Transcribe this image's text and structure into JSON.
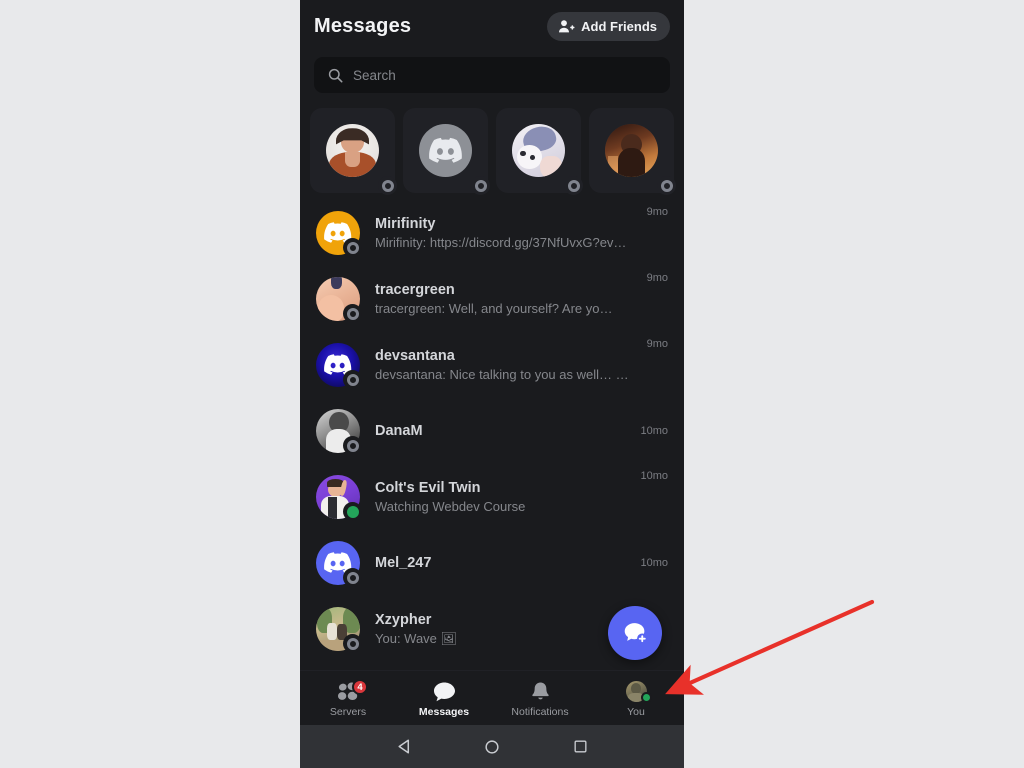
{
  "header": {
    "title": "Messages",
    "add_friends_label": "Add Friends",
    "add_friends_icon": "person-add-icon"
  },
  "search": {
    "placeholder": "Search",
    "value": "",
    "icon": "search-icon"
  },
  "stories": [
    {
      "name": "story-1",
      "status": "offline",
      "avatar_type": "photo-woman-brown-top"
    },
    {
      "name": "story-2",
      "status": "offline",
      "avatar_type": "discord-default-gray"
    },
    {
      "name": "story-3",
      "status": "offline",
      "avatar_type": "photo-anime-white"
    },
    {
      "name": "story-4",
      "status": "offline",
      "avatar_type": "photo-woman-sunset"
    }
  ],
  "conversations": [
    {
      "name": "Mirifinity",
      "preview": "Mirifinity: https://discord.gg/37NfUvxG?even…",
      "time": "9mo",
      "status": "offline",
      "avatar_type": "discord-default-orange"
    },
    {
      "name": "tracergreen",
      "preview": "tracergreen: Well, and yourself? Are yo…",
      "time": "9mo",
      "status": "offline",
      "avatar_type": "photo-skin-closeup"
    },
    {
      "name": "devsantana",
      "preview": "devsantana: Nice talking to you as well… by…",
      "time": "9mo",
      "status": "offline",
      "avatar_type": "discord-default-blue-glow"
    },
    {
      "name": "DanaM",
      "preview": "",
      "time": "10mo",
      "status": "offline",
      "avatar_type": "photo-bw-portrait"
    },
    {
      "name": "Colt's Evil Twin",
      "preview": "Watching Webdev Course",
      "time": "10mo",
      "status": "online",
      "avatar_type": "photo-man-purple"
    },
    {
      "name": "Mel_247",
      "preview": "",
      "time": "10mo",
      "status": "offline",
      "avatar_type": "discord-default-blurple"
    },
    {
      "name": "Xzypher",
      "preview": "You: Wave 🖼",
      "time": "",
      "status": "offline",
      "avatar_type": "photo-couple-outdoor"
    }
  ],
  "fab": {
    "name": "new-message-fab",
    "icon": "chat-bubble-plus-icon",
    "color": "#5865F2"
  },
  "bottom_nav": {
    "items": [
      {
        "label": "Servers",
        "icon": "servers-icon",
        "badge": "4",
        "active": false
      },
      {
        "label": "Messages",
        "icon": "messages-bubble-icon",
        "badge": "",
        "active": true
      },
      {
        "label": "Notifications",
        "icon": "bell-icon",
        "badge": "",
        "active": false
      },
      {
        "label": "You",
        "icon": "user-avatar-icon",
        "badge": "",
        "active": false,
        "status": "online"
      }
    ]
  },
  "system_bar": {
    "back": "back-triangle-icon",
    "home": "home-circle-icon",
    "recents": "recents-square-icon"
  },
  "annotation": {
    "type": "arrow",
    "color": "#e8312a",
    "points_to": "You"
  },
  "colors": {
    "app_bg": "#1a1b1e",
    "card_bg": "#202126",
    "search_bg": "#111214",
    "accent": "#5865F2",
    "online": "#23a55a",
    "badge_red": "#da373c",
    "page_bg": "#e8e9eb"
  }
}
